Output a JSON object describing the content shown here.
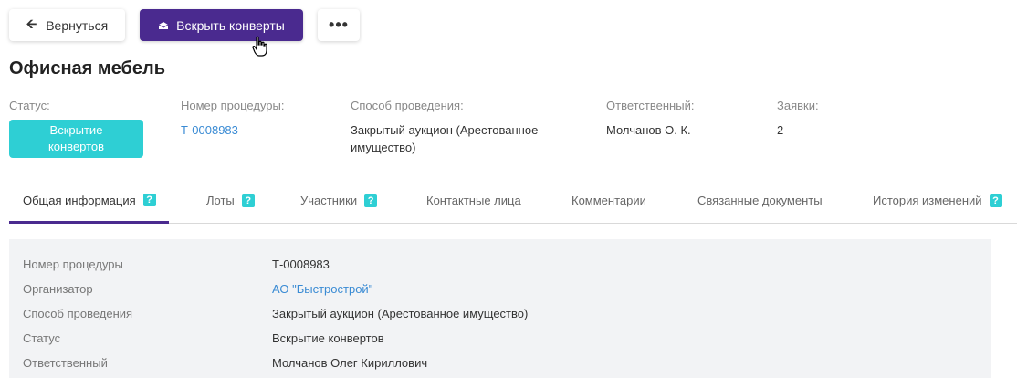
{
  "toolbar": {
    "back_label": "Вернуться",
    "open_envelopes_label": "Вскрыть конверты",
    "more_label": "•••"
  },
  "page": {
    "title": "Офисная мебель"
  },
  "summary": {
    "status_label": "Статус:",
    "status_value": "Вскрытие конвертов",
    "procedure_label": "Номер процедуры:",
    "procedure_value": "Т-0008983",
    "method_label": "Способ проведения:",
    "method_value_line1": "Закрытый аукцион (Арестованное",
    "method_value_line2": "имущество)",
    "responsible_label": "Ответственный:",
    "responsible_value": "Молчанов О. К.",
    "bids_label": "Заявки:",
    "bids_value": "2"
  },
  "tabs": [
    {
      "label": "Общая информация",
      "help": "?"
    },
    {
      "label": "Лоты",
      "help": "?"
    },
    {
      "label": "Участники",
      "help": "?"
    },
    {
      "label": "Контактные лица"
    },
    {
      "label": "Комментарии"
    },
    {
      "label": "Связанные документы"
    },
    {
      "label": "История изменений",
      "help": "?"
    }
  ],
  "details": [
    {
      "key": "Номер процедуры",
      "value": "Т-0008983"
    },
    {
      "key": "Организатор",
      "value": "АО \"Быстрострой\""
    },
    {
      "key": "Способ проведения",
      "value": "Закрытый аукцион (Арестованное имущество)"
    },
    {
      "key": "Статус",
      "value": "Вскрытие конвертов"
    },
    {
      "key": "Ответственный",
      "value": "Молчанов Олег Кириллович"
    }
  ],
  "colors": {
    "primary": "#4a2a8f",
    "accent": "#2ecfd4",
    "link": "#3a8bd4",
    "panel_bg": "#f2f3f5"
  }
}
